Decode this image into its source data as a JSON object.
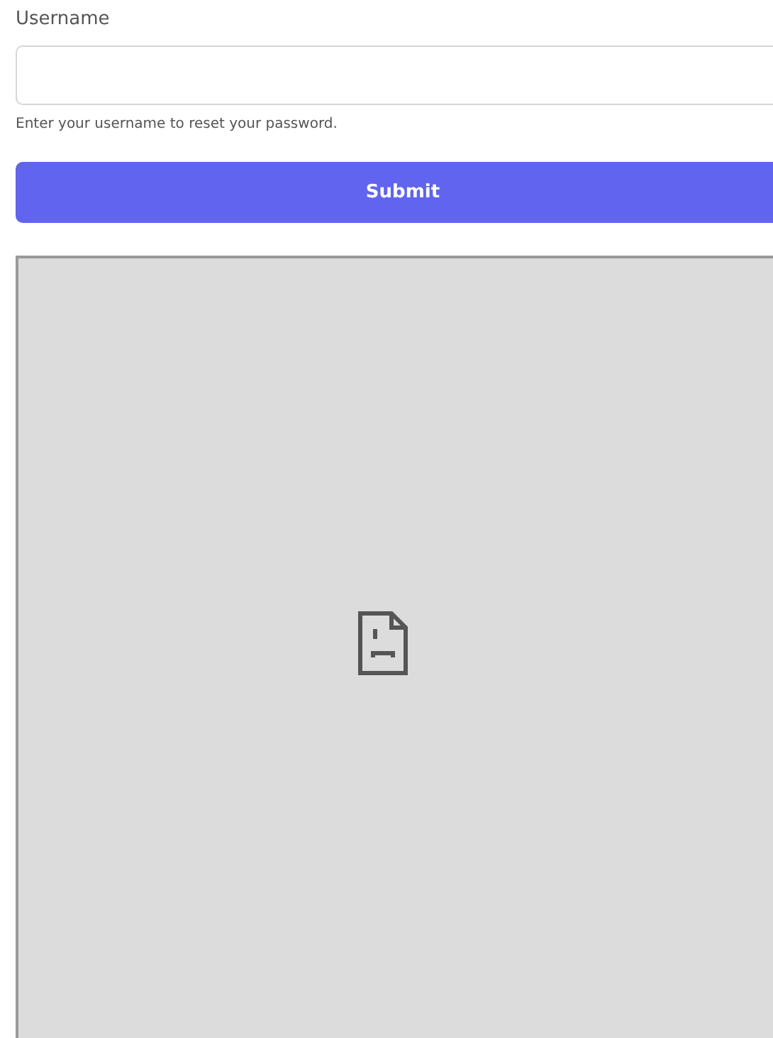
{
  "form": {
    "label": "Username",
    "hint": "Enter your username to reset your password.",
    "button": "Submit"
  },
  "embed": {
    "kind": "broken"
  }
}
